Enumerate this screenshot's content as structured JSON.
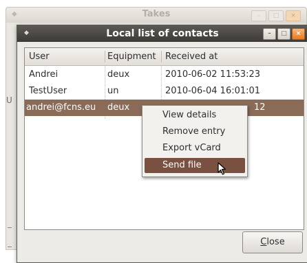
{
  "parent_window": {
    "title": "Takes",
    "side_letter": "U"
  },
  "dialog": {
    "title": "Local list of contacts",
    "columns": [
      "User",
      "Equipment",
      "Received at"
    ],
    "rows": [
      {
        "user": "Andrei",
        "equipment": "deux",
        "received": "2010-06-02 11:53:23"
      },
      {
        "user": "TestUser",
        "equipment": "un",
        "received": "2010-06-04 16:01:01"
      },
      {
        "user": "andrei@fcns.eu",
        "equipment": "deux",
        "received": "2010-06-02 11:53:12",
        "visible_received_tail": "12",
        "selected": true
      }
    ],
    "close_button": {
      "mnemonic": "C",
      "rest": "lose"
    }
  },
  "context_menu": {
    "items": [
      {
        "label": "View details"
      },
      {
        "label": "Remove entry"
      },
      {
        "label": "Export vCard"
      },
      {
        "label": "Send file",
        "hovered": true
      }
    ]
  },
  "colors": {
    "titlebar": "#4b4844",
    "selection": "#8a6b58",
    "menu_hover": "#7a5140",
    "close_button_accent": "#e87a22"
  },
  "icons": {
    "window_menu": "diamond-icon",
    "minimize": "minimize-icon",
    "maximize": "maximize-icon",
    "close": "close-icon",
    "pointer": "mouse-pointer-icon"
  }
}
